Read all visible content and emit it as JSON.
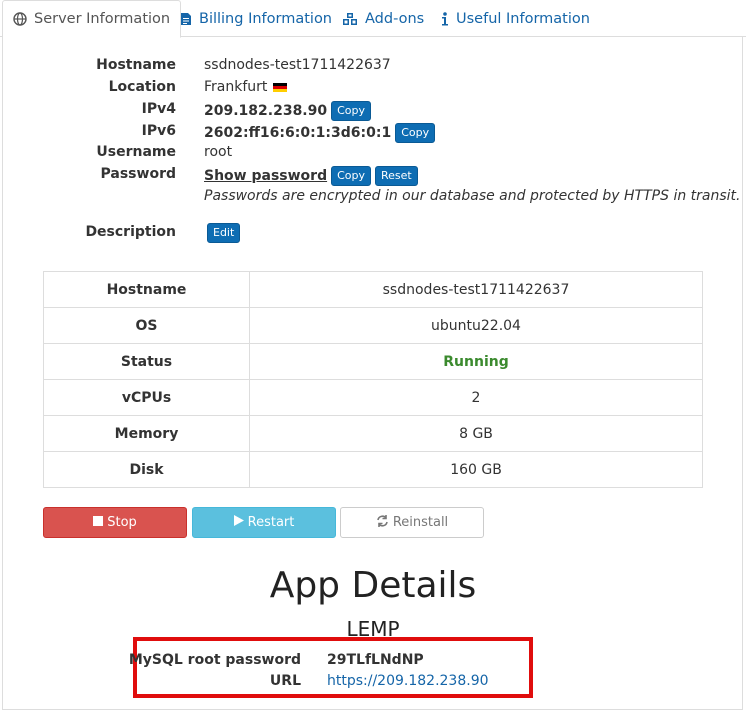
{
  "tabs": [
    {
      "label": "Server Information",
      "icon": "globe-icon",
      "active": true
    },
    {
      "label": "Billing Information",
      "icon": "document-icon",
      "active": false
    },
    {
      "label": "Add-ons",
      "icon": "cubes-icon",
      "active": false
    },
    {
      "label": "Useful Information",
      "icon": "info-icon",
      "active": false
    }
  ],
  "info": {
    "hostname_label": "Hostname",
    "hostname": "ssdnodes-test1711422637",
    "location_label": "Location",
    "location": "Frankfurt",
    "ipv4_label": "IPv4",
    "ipv4": "209.182.238.90",
    "ipv6_label": "IPv6",
    "ipv6": "2602:ff16:6:0:1:3d6:0:1",
    "username_label": "Username",
    "username": "root",
    "password_label": "Password",
    "show_password": "Show password",
    "copy_label": "Copy",
    "reset_label": "Reset",
    "password_note": "Passwords are encrypted in our database and protected by HTTPS in transit.",
    "description_label": "Description",
    "edit_label": "Edit"
  },
  "spec_table": [
    {
      "key": "Hostname",
      "value": "ssdnodes-test1711422637"
    },
    {
      "key": "OS",
      "value": "ubuntu22.04"
    },
    {
      "key": "Status",
      "value": "Running"
    },
    {
      "key": "vCPUs",
      "value": "2"
    },
    {
      "key": "Memory",
      "value": "8 GB"
    },
    {
      "key": "Disk",
      "value": "160 GB"
    }
  ],
  "actions": {
    "stop": "Stop",
    "restart": "Restart",
    "reinstall": "Reinstall"
  },
  "app": {
    "title": "App Details",
    "stack": "LEMP",
    "mysql_label": "MySQL root password",
    "mysql_value": "29TLfLNdNP",
    "url_label": "URL",
    "url_value": "https://209.182.238.90"
  },
  "colors": {
    "link": "#1565a8",
    "primary_button": "#0e6db3",
    "stop": "#d9534f",
    "restart": "#5bc0de",
    "running": "#3b8a2e",
    "highlight_box": "#e00d0d"
  }
}
